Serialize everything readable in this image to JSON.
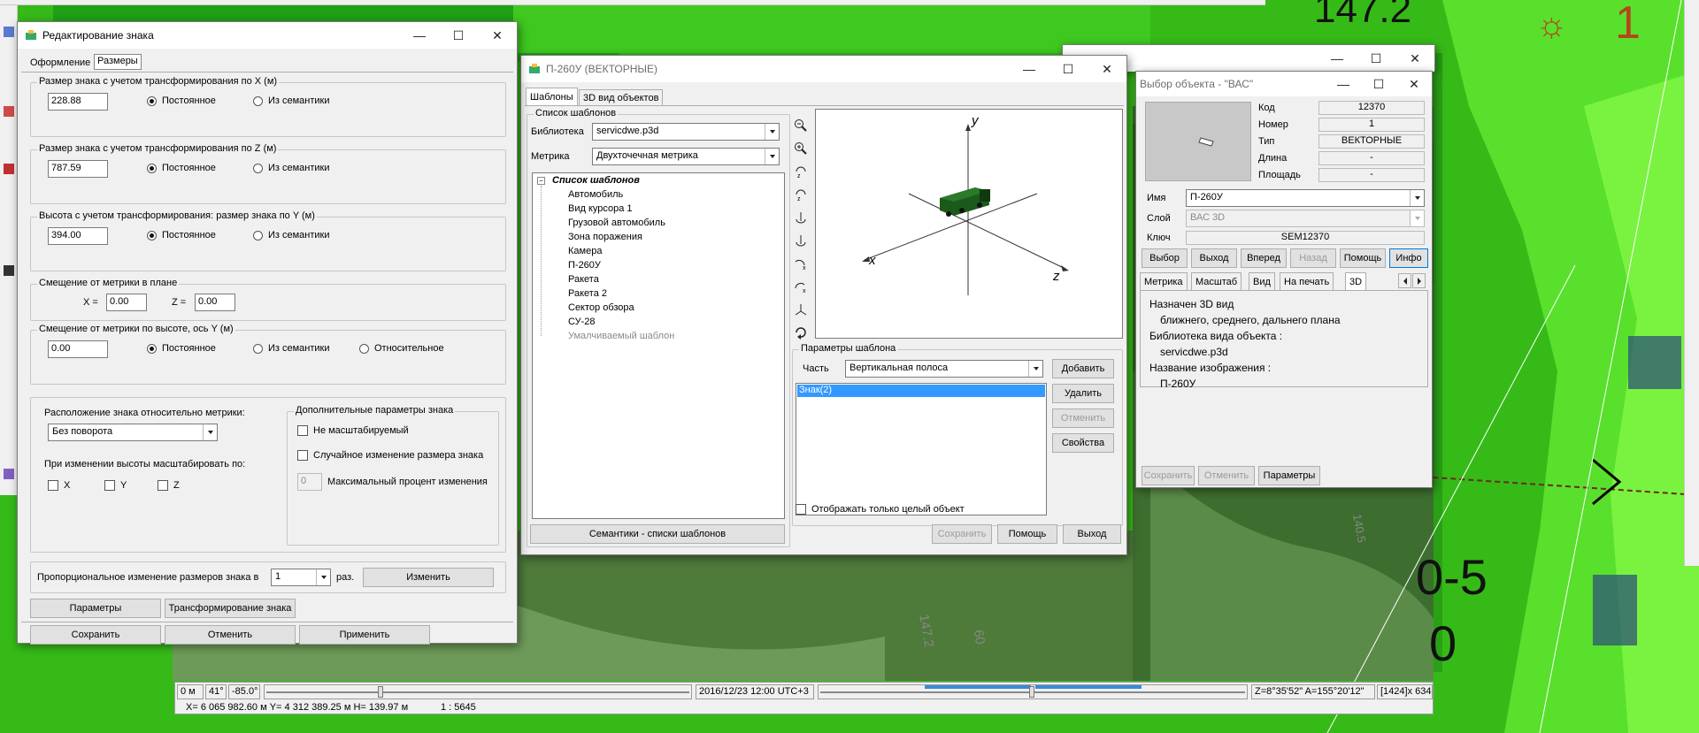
{
  "map": {
    "label_top": "147.2",
    "label_red": "1",
    "label_big1": "0-5",
    "label_big2": "0",
    "label_140": "140.5",
    "label_147": "147.2",
    "label_60": "60"
  },
  "edit_window": {
    "title": "Редактирование знака",
    "tabs": [
      "Оформление",
      "Размеры"
    ],
    "groups": {
      "x": {
        "legend": "Размер знака с учетом трансформирования по X (м)",
        "value": "228.88",
        "opt1": "Постоянное",
        "opt2": "Из семантики"
      },
      "z": {
        "legend": "Размер знака с учетом трансформирования по Z (м)",
        "value": "787.59",
        "opt1": "Постоянное",
        "opt2": "Из семантики"
      },
      "y": {
        "legend": "Высота с учетом трансформирования: размер знака по Y (м)",
        "value": "394.00",
        "opt1": "Постоянное",
        "opt2": "Из семантики"
      },
      "plan": {
        "legend": "Смещение от метрики в плане",
        "x_label": "X =",
        "x_value": "0.00",
        "z_label": "Z =",
        "z_value": "0.00"
      },
      "height": {
        "legend": "Смещение от метрики по высоте, ось Y (м)",
        "value": "0.00",
        "opt1": "Постоянное",
        "opt2": "Из семантики",
        "opt3": "Относительное"
      }
    },
    "placement_label": "Расположение знака относительно метрики:",
    "placement_value": "Без поворота",
    "scale_label": "При изменении высоты масштабировать по:",
    "scale_x": "X",
    "scale_y": "Y",
    "scale_z": "Z",
    "extra_legend": "Дополнительные параметры знака",
    "extra_opt1": "Не масштабируемый",
    "extra_opt2": "Случайное изменение размера знака",
    "extra_pct_value": "0",
    "extra_pct_label": "Максимальный процент изменения",
    "prop_label": "Пропорциональное изменение размеров знака в",
    "prop_value": "1",
    "prop_unit": "раз.",
    "prop_button": "Изменить",
    "params_button": "Параметры",
    "transform_button": "Трансформирование знака",
    "save_button": "Сохранить",
    "cancel_button": "Отменить",
    "apply_button": "Применить"
  },
  "p260_window": {
    "title": "П-260У (ВЕКТОРНЫЕ)",
    "tabs": [
      "Шаблоны",
      "3D вид объектов"
    ],
    "list_legend": "Список шаблонов",
    "library_label": "Библиотека",
    "library_value": "servicdwe.p3d",
    "metric_label": "Метрика",
    "metric_value": "Двухточечная метрика",
    "tree_root": "Список шаблонов",
    "tree_items": [
      "Автомобиль",
      "Вид курсора 1",
      "Грузовой автомобиль",
      "Зона поражения",
      "Камера",
      "П-260У",
      "Ракета",
      "Ракета 2",
      "Сектор обзора",
      "СУ-28",
      "Умалчиваемый шаблон"
    ],
    "semantics_button": "Семантики - списки шаблонов",
    "axis_y": "y",
    "axis_x": "x",
    "axis_z": "z",
    "params_legend": "Параметры шаблона",
    "part_label": "Часть",
    "part_value": "Вертикальная полоса",
    "part_list": [
      "Знак(2)"
    ],
    "add_button": "Добавить",
    "delete_button": "Удалить",
    "cancel_button": "Отменить",
    "props_button": "Свойства",
    "only_whole": "Отображать только целый объект",
    "save_button": "Сохранить",
    "help_button": "Помощь",
    "exit_button": "Выход"
  },
  "select_window": {
    "title": "Выбор объекта - \"ВАС\"",
    "code_label": "Код",
    "code_value": "12370",
    "number_label": "Номер",
    "number_value": "1",
    "type_label": "Тип",
    "type_value": "ВЕКТОРНЫЕ",
    "length_label": "Длина",
    "length_value": "-",
    "area_label": "Площадь",
    "area_value": "-",
    "name_label": "Имя",
    "name_value": "П-260У",
    "layer_label": "Слой",
    "layer_value": "ВАС 3D",
    "key_label": "Ключ",
    "key_value": "SEM12370",
    "nav_buttons": [
      "Выбор",
      "Выход",
      "Вперед",
      "Назад",
      "Помощь",
      "Инфо"
    ],
    "tabs": [
      "Метрика",
      "Масштаб",
      "Вид",
      "На печать",
      "3D"
    ],
    "info_lines": [
      "Назначен 3D вид",
      "ближнего, среднего, дальнего плана",
      "Библиотека вида объекта :",
      "servicdwe.p3d",
      "Название изображения :",
      "П-260У"
    ],
    "save_button": "Сохранить",
    "cancel_button": "Отменить",
    "params_button": "Параметры"
  },
  "statusbar": {
    "dist": "0 м",
    "angle1": "41°",
    "angle2": "-85.0°",
    "datetime": "2016/12/23  12:00  UTC+3",
    "orient": "Z=8°35'52\"  A=155°20'12\"",
    "size": "[1424]x 634",
    "coords": "X= 6 065 982.60 м  Y= 4 312 389.25 м  H= 139.97 м",
    "scale": "1 : 5645"
  },
  "colors": {
    "map_green": "#3ec21e",
    "map_dark": "#1e8a0d",
    "selection": "#3399ff",
    "dark_red": "#b8431a"
  }
}
